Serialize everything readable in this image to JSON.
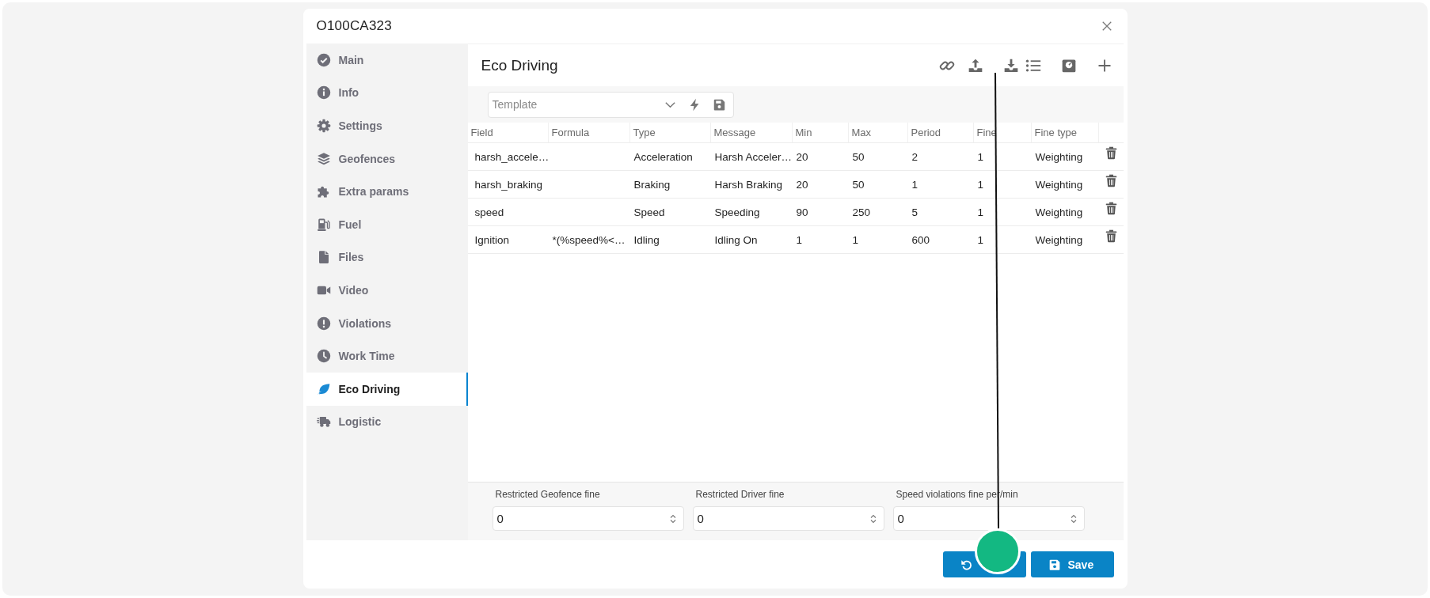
{
  "dialog": {
    "title": "O100CA323"
  },
  "sidebar": {
    "items": [
      {
        "label": "Main",
        "selected": false
      },
      {
        "label": "Info",
        "selected": false
      },
      {
        "label": "Settings",
        "selected": false
      },
      {
        "label": "Geofences",
        "selected": false
      },
      {
        "label": "Extra params",
        "selected": false
      },
      {
        "label": "Fuel",
        "selected": false
      },
      {
        "label": "Files",
        "selected": false
      },
      {
        "label": "Video",
        "selected": false
      },
      {
        "label": "Violations",
        "selected": false
      },
      {
        "label": "Work Time",
        "selected": false
      },
      {
        "label": "Eco Driving",
        "selected": true
      },
      {
        "label": "Logistic",
        "selected": false
      }
    ]
  },
  "panel": {
    "title": "Eco Driving",
    "template": {
      "placeholder": "Template"
    }
  },
  "table": {
    "columns": [
      "Field",
      "Formula",
      "Type",
      "Message",
      "Min",
      "Max",
      "Period",
      "Fine",
      "Fine type"
    ],
    "rows": [
      {
        "field": "harsh_accele…",
        "type": "Acceleration",
        "message": "Harsh Acceler…",
        "min": "20",
        "max": "50",
        "period": "2",
        "fine": "1",
        "fine_type": "Weighting"
      },
      {
        "field": "harsh_braking",
        "type": "Braking",
        "message": "Harsh Braking",
        "min": "20",
        "max": "50",
        "period": "1",
        "fine": "1",
        "fine_type": "Weighting"
      },
      {
        "field": "speed",
        "type": "Speed",
        "message": "Speeding",
        "min": "90",
        "max": "250",
        "period": "5",
        "fine": "1",
        "fine_type": "Weighting"
      },
      {
        "field": "Ignition",
        "formula": "*(%speed%<…",
        "type": "Idling",
        "message": "Idling On",
        "min": "1",
        "max": "1",
        "period": "600",
        "fine": "1",
        "fine_type": "Weighting"
      }
    ]
  },
  "fines": [
    {
      "label": "Restricted Geofence fine",
      "value": "0"
    },
    {
      "label": "Restricted Driver fine",
      "value": "0"
    },
    {
      "label": "Speed violations fine per/min",
      "value": "0"
    }
  ],
  "buttons": [
    {
      "kind": "reset"
    },
    {
      "kind": "save",
      "label": "Save"
    }
  ]
}
